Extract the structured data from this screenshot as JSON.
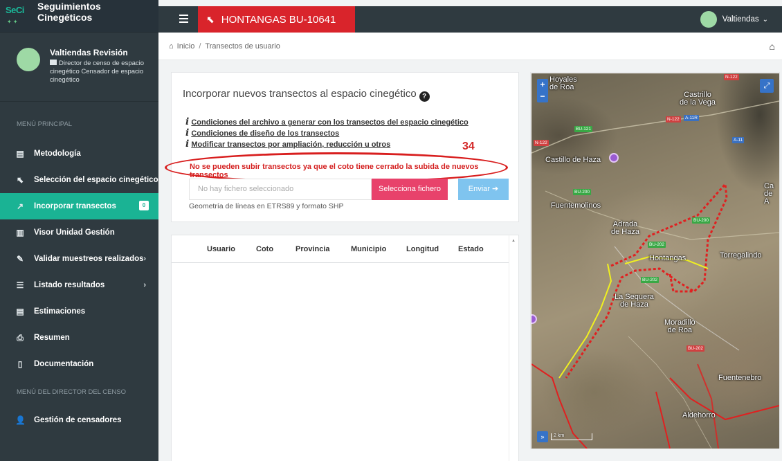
{
  "sidebar": {
    "brand": {
      "logo": "SeCi",
      "title": "Seguimientos Cinegéticos"
    },
    "user": {
      "name": "Valtiendas Revisión",
      "role": "Director de censo de espacio cinegético Censador de espacio cinegético"
    },
    "main_menu_heading": "MENÚ PRINCIPAL",
    "items": [
      {
        "label": "Metodología",
        "icon": "document-icon"
      },
      {
        "label": "Selección del espacio cinegético",
        "icon": "cursor-icon"
      },
      {
        "label": "Incorporar transectos",
        "icon": "trend-icon",
        "badge": "0",
        "active": true
      },
      {
        "label": "Visor Unidad Gestión",
        "icon": "map-icon"
      },
      {
        "label": "Validar muestreos realizados",
        "icon": "edit-icon",
        "chevron": "›"
      },
      {
        "label": "Listado resultados",
        "icon": "list-icon",
        "chevron": "›"
      },
      {
        "label": "Estimaciones",
        "icon": "document-icon"
      },
      {
        "label": "Resumen",
        "icon": "pdf-icon"
      },
      {
        "label": "Documentación",
        "icon": "file-icon"
      }
    ],
    "director_menu_heading": "MENÚ DEL DIRECTOR DEL CENSO",
    "director_items": [
      {
        "label": "Gestión de censadores",
        "icon": "user-icon"
      }
    ]
  },
  "header": {
    "space_name": "HONTANGAS BU-10641",
    "user": "Valtiendas",
    "caret": "⌄"
  },
  "breadcrumb": {
    "home": "Inicio",
    "separator": "/",
    "current": "Transectos de usuario"
  },
  "upload": {
    "title": "Incorporar nuevos transectos al espacio cinegético",
    "links": [
      "Condiciones del archivo a generar con los transectos del espacio cinegético",
      "Condiciones de diseño de los transectos",
      "Modificar transectos por ampliación, reducción u otros"
    ],
    "annotation_number": "34",
    "warning": "No se pueden subir transectos ya que el coto tiene cerrado la subida de nuevos transectos",
    "file_placeholder": "No hay fichero seleccionado",
    "select_button": "Selecciona fichero",
    "send_button": "Enviar",
    "geometry_note": "Geometría de líneas en ETRS89 y formato SHP"
  },
  "table": {
    "columns": [
      "Usuario",
      "Coto",
      "Provincia",
      "Municipio",
      "Longitud",
      "Estado"
    ],
    "rows": []
  },
  "map": {
    "labels": [
      {
        "text": "Hoyales\nde Roa"
      },
      {
        "text": "Castrillo\nde la Vega"
      },
      {
        "text": "Castillo de Haza"
      },
      {
        "text": "Fuentemolinos"
      },
      {
        "text": "Adrada\nde Haza"
      },
      {
        "text": "Hontangas"
      },
      {
        "text": "Torregalindo"
      },
      {
        "text": "La Sequera\nde Haza"
      },
      {
        "text": "Moradillo\nde Roa"
      },
      {
        "text": "Fuentenebro"
      },
      {
        "text": "Aldehorro"
      },
      {
        "text": "Ca\nde A"
      }
    ],
    "roads": [
      "N-122",
      "N-122",
      "A-11R",
      "BU-121",
      "A-11",
      "N-122",
      "BU-200",
      "BU-200",
      "BU-202",
      "BU-202",
      "BU-202"
    ],
    "zoom_in": "+",
    "zoom_out": "−",
    "scale": "2 km",
    "colors": {
      "boundary": "#e02020",
      "transect": "#f0f020"
    }
  }
}
